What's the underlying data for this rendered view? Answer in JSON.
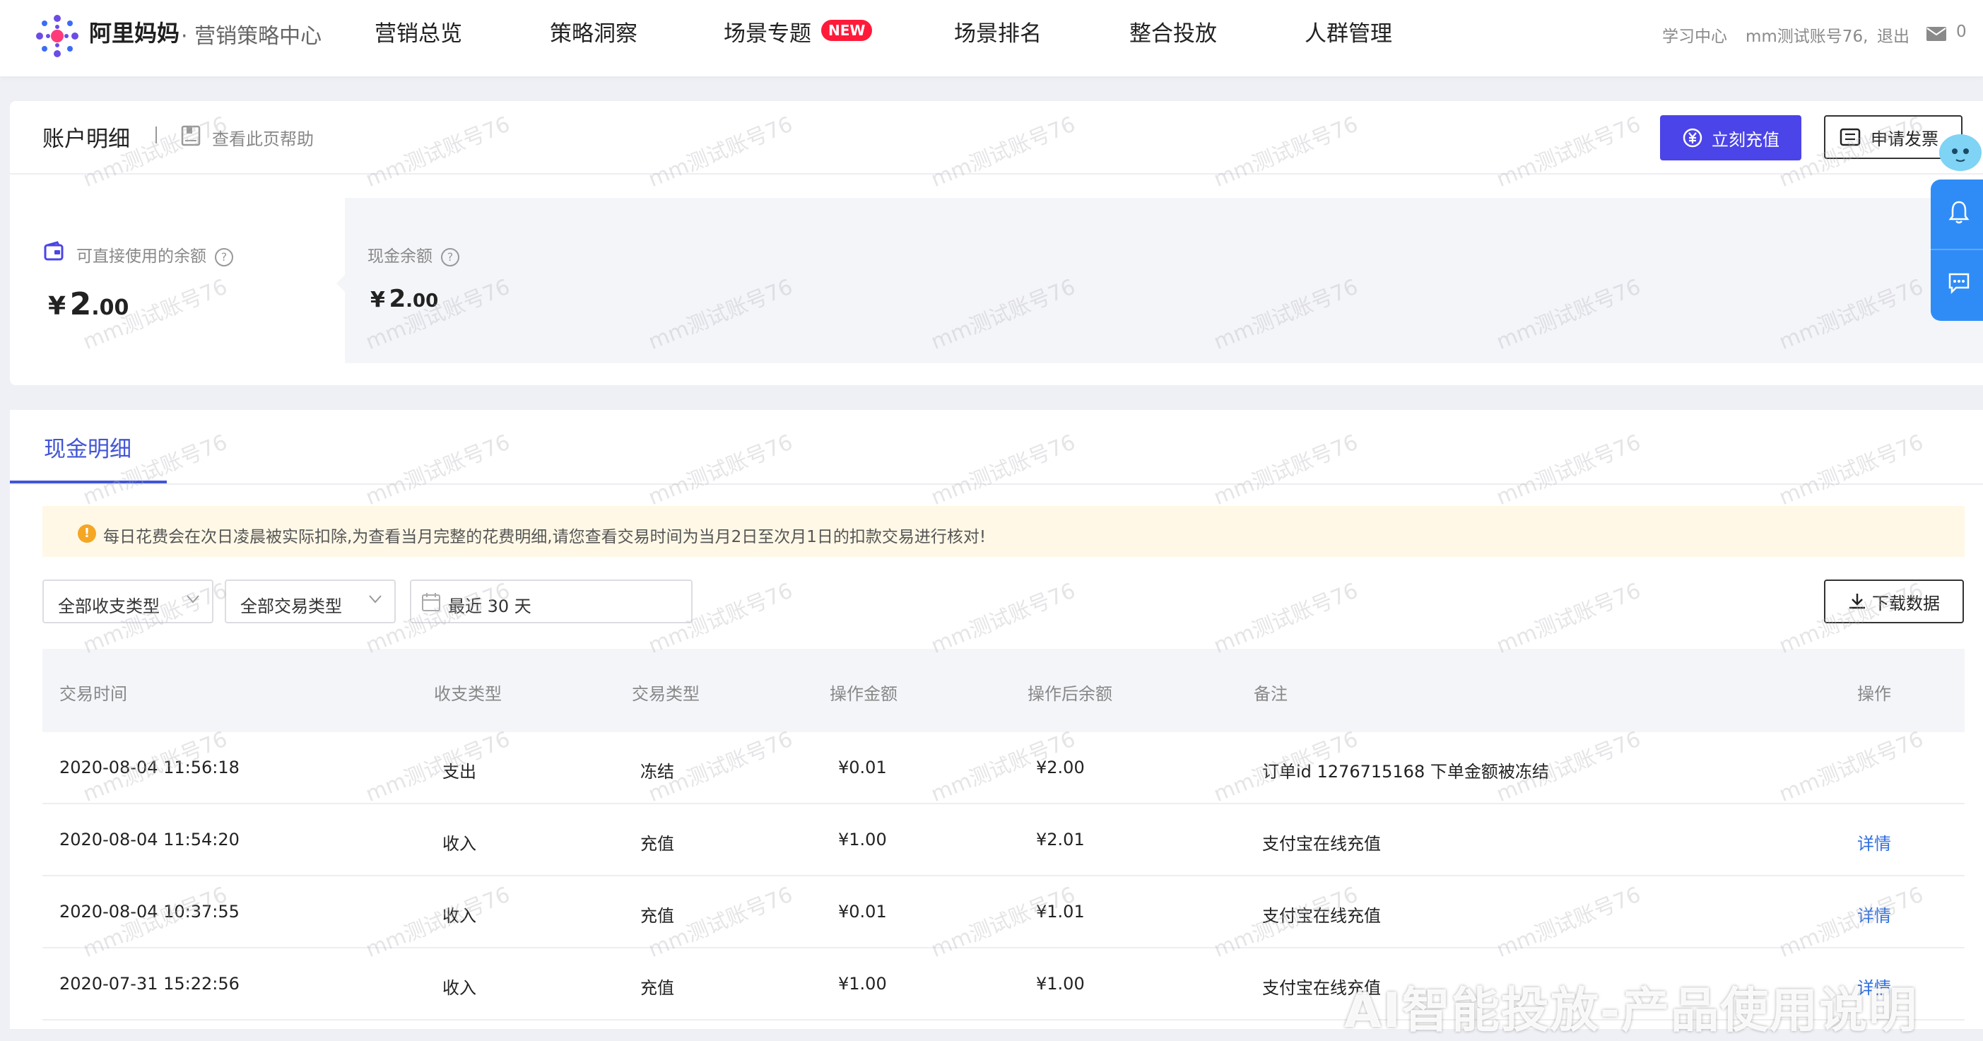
{
  "header": {
    "brand": "阿里妈妈",
    "brand_sub": "· 营销策略中心",
    "nav": [
      "营销总览",
      "策略洞察",
      "场景专题",
      "场景排名",
      "整合投放",
      "人群管理"
    ],
    "new_badge": "NEW",
    "learning_center": "学习中心",
    "account": "mm测试账号76,",
    "logout": "退出",
    "mail_count": "0"
  },
  "account_card": {
    "title": "账户明细",
    "help": "查看此页帮助",
    "recharge_button": "立刻充值",
    "invoice_button": "申请发票",
    "usable_balance_label": "可直接使用的余额",
    "usable_balance": {
      "symbol": "¥",
      "integer": "2",
      "decimal": ".00"
    },
    "cash_balance_label": "现金余额",
    "cash_balance": {
      "symbol": "¥",
      "integer": "2",
      "decimal": ".00"
    }
  },
  "cash_detail": {
    "tab": "现金明细",
    "notice": "每日花费会在次日凌晨被实际扣除,为查看当月完整的花费明细,请您查看交易时间为当月2日至次月1日的扣款交易进行核对!",
    "filters": {
      "income_type": "全部收支类型",
      "trade_type": "全部交易类型",
      "date_range": "最近 30 天"
    },
    "download_button": "下载数据",
    "columns": [
      "交易时间",
      "收支类型",
      "交易类型",
      "操作金额",
      "操作后余额",
      "备注",
      "操作"
    ],
    "rows": [
      {
        "time": "2020-08-04 11:56:18",
        "io": "支出",
        "type": "冻结",
        "amount": "¥0.01",
        "after": "¥2.00",
        "remark": "订单id 1276715168 下单金额被冻结",
        "action": ""
      },
      {
        "time": "2020-08-04 11:54:20",
        "io": "收入",
        "type": "充值",
        "amount": "¥1.00",
        "after": "¥2.01",
        "remark": "支付宝在线充值",
        "action": "详情"
      },
      {
        "time": "2020-08-04 10:37:55",
        "io": "收入",
        "type": "充值",
        "amount": "¥0.01",
        "after": "¥1.01",
        "remark": "支付宝在线充值",
        "action": "详情"
      },
      {
        "time": "2020-07-31 15:22:56",
        "io": "收入",
        "type": "充值",
        "amount": "¥1.00",
        "after": "¥1.00",
        "remark": "支付宝在线充值",
        "action": "详情"
      }
    ]
  },
  "watermark": "mm测试账号76",
  "overlay_caption": "AI智能投放-产品使用说明",
  "colors": {
    "primary": "#4b44e8",
    "tab_active": "#4155d6",
    "link": "#2f6fe0",
    "side_panel": "#2f8cf6",
    "new_badge": "#ff1a3a"
  }
}
